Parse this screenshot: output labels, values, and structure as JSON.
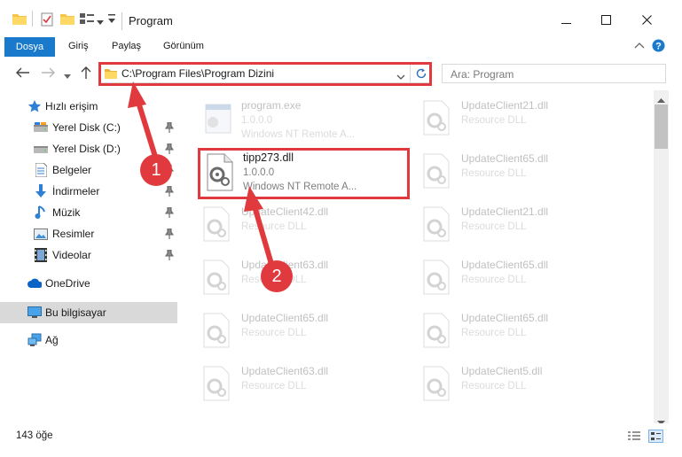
{
  "window": {
    "title": "Program",
    "controls": {
      "minimize_icon": "minimize-icon",
      "maximize_icon": "maximize-icon",
      "close_icon": "close-icon"
    }
  },
  "ribbon": {
    "tabs": [
      {
        "label": "Dosya",
        "active": true
      },
      {
        "label": "Giriş"
      },
      {
        "label": "Paylaş"
      },
      {
        "label": "Görünüm"
      }
    ]
  },
  "address": {
    "path": "C:\\Program Files\\Program Dizini",
    "search_placeholder": "Ara: Program"
  },
  "sidebar": {
    "items": [
      {
        "label": "Hızlı erişim",
        "icon": "star-icon"
      },
      {
        "label": "Yerel Disk (C:)",
        "icon": "drive-icon",
        "pinned": true
      },
      {
        "label": "Yerel Disk (D:)",
        "icon": "drive-icon",
        "pinned": true
      },
      {
        "label": "Belgeler",
        "icon": "document-icon",
        "pinned": true
      },
      {
        "label": "İndirmeler",
        "icon": "download-icon",
        "pinned": true
      },
      {
        "label": "Müzik",
        "icon": "music-icon",
        "pinned": true
      },
      {
        "label": "Resimler",
        "icon": "pictures-icon",
        "pinned": true
      },
      {
        "label": "Videolar",
        "icon": "video-icon",
        "pinned": true
      },
      {
        "label": "OneDrive",
        "icon": "cloud-icon"
      },
      {
        "label": "Bu bilgisayar",
        "icon": "computer-icon",
        "selected": true
      },
      {
        "label": "Ağ",
        "icon": "network-icon"
      }
    ]
  },
  "files": [
    {
      "name": "program.exe",
      "line1": "1.0.0.0",
      "line2": "Windows NT Remote A..."
    },
    {
      "name": "UpdateClient21.dll",
      "line1": "Resource DLL"
    },
    {
      "name": "tipp273.dll",
      "line1": "1.0.0.0",
      "line2": "Windows NT Remote A..."
    },
    {
      "name": "UpdateClient65.dll",
      "line1": "Resource DLL"
    },
    {
      "name": "UpdateClient42.dll",
      "line1": "Resource DLL"
    },
    {
      "name": "UpdateClient21.dll",
      "line1": "Resource DLL"
    },
    {
      "name": "UpdateClient63.dll",
      "line1": "Resource DLL"
    },
    {
      "name": "UpdateClient65.dll",
      "line1": "Resource DLL"
    },
    {
      "name": "UpdateClient65.dll",
      "line1": "Resource DLL"
    },
    {
      "name": "UpdateClient65.dll",
      "line1": "Resource DLL"
    },
    {
      "name": "UpdateClient63.dll",
      "line1": "Resource DLL"
    },
    {
      "name": "UpdateClient5.dll",
      "line1": "Resource DLL"
    }
  ],
  "status": {
    "item_count": "143 öğe"
  },
  "callouts": [
    "1",
    "2"
  ],
  "colors": {
    "accent": "#1979ca",
    "highlight": "#e0393e"
  }
}
